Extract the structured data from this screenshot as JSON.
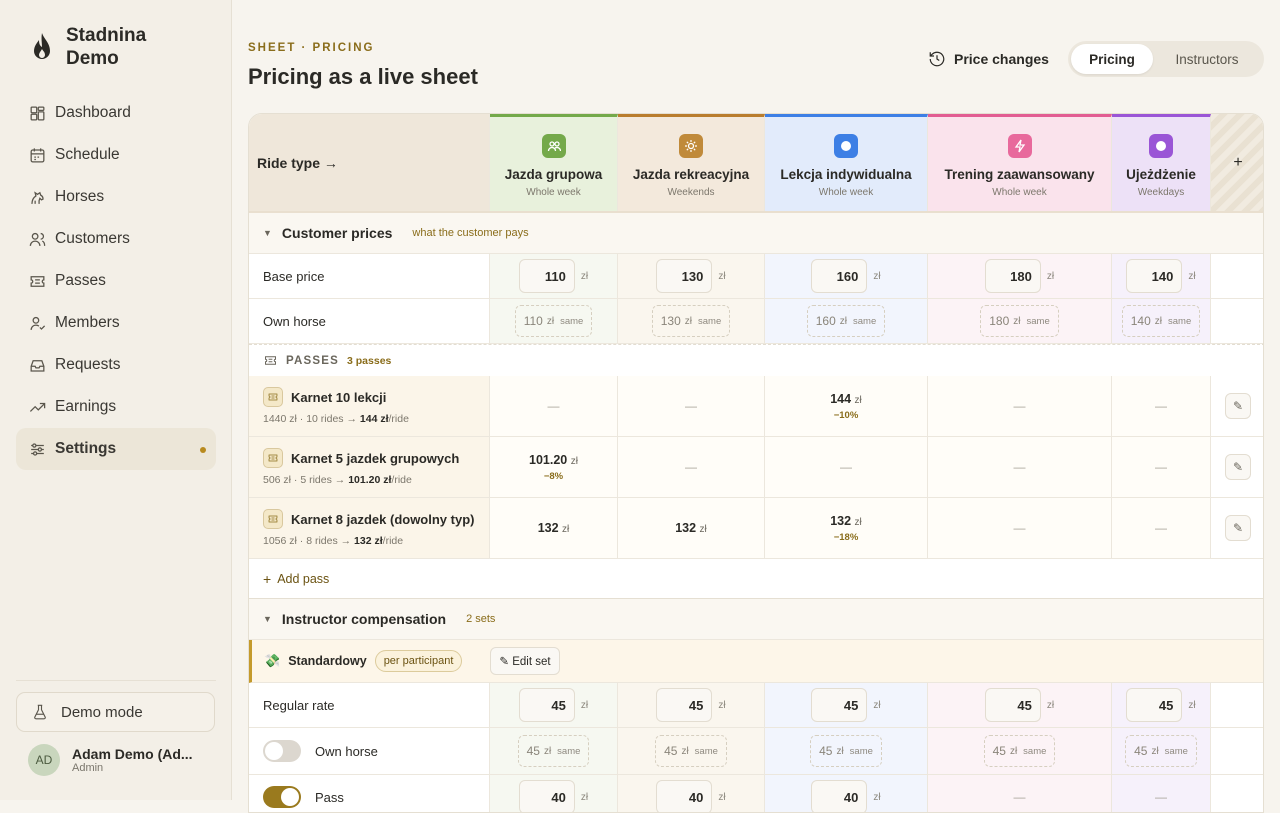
{
  "app": {
    "name": "Stadnina Demo"
  },
  "nav": [
    {
      "label": "Dashboard",
      "icon": "dashboard-icon"
    },
    {
      "label": "Schedule",
      "icon": "calendar-icon"
    },
    {
      "label": "Horses",
      "icon": "horse-icon"
    },
    {
      "label": "Customers",
      "icon": "users-icon"
    },
    {
      "label": "Passes",
      "icon": "ticket-icon"
    },
    {
      "label": "Members",
      "icon": "user-check-icon"
    },
    {
      "label": "Requests",
      "icon": "inbox-icon"
    },
    {
      "label": "Earnings",
      "icon": "trend-icon"
    },
    {
      "label": "Settings",
      "icon": "sliders-icon",
      "active": true
    }
  ],
  "demo": {
    "label": "Demo mode"
  },
  "user": {
    "initials": "AD",
    "name": "Adam Demo (Ad...",
    "role": "Admin"
  },
  "header": {
    "eyebrow": "SHEET · PRICING",
    "title": "Pricing as a live sheet",
    "price_changes": "Price changes",
    "tabs": [
      "Pricing",
      "Instructors"
    ]
  },
  "sheet": {
    "corner": "Ride type →",
    "add_col": "+",
    "columns": [
      {
        "name": "Jazda grupowa",
        "sub": "Whole week",
        "color": "#74a94a"
      },
      {
        "name": "Jazda rekreacyjna",
        "sub": "Weekends",
        "color": "#b97d2e"
      },
      {
        "name": "Lekcja indywidualna",
        "sub": "Whole week",
        "color": "#3d7fe5"
      },
      {
        "name": "Trening zaawansowany",
        "sub": "Whole week",
        "color": "#e25d92"
      },
      {
        "name": "Ujeżdżenie",
        "sub": "Weekdays",
        "color": "#9a55d6"
      }
    ],
    "unit": "zł",
    "same": "same",
    "customer": {
      "title": "Customer prices",
      "note": "what the customer pays",
      "base_label": "Base price",
      "base": [
        "110",
        "130",
        "160",
        "180",
        "140"
      ],
      "own_label": "Own horse",
      "own": [
        "110",
        "130",
        "160",
        "180",
        "140"
      ]
    },
    "passes": {
      "title": "PASSES",
      "count": "3 passes",
      "rows": [
        {
          "name": "Karnet 10 lekcji",
          "sub_pre": "1440 zł · 10 rides →",
          "sub_val": "144 zł",
          "sub_post": "/ride",
          "cells": [
            null,
            null,
            {
              "v": "144",
              "d": "−10%"
            },
            null,
            null
          ]
        },
        {
          "name": "Karnet 5 jazdek grupowych",
          "sub_pre": "506 zł · 5 rides →",
          "sub_val": "101.20 zł",
          "sub_post": "/ride",
          "cells": [
            {
              "v": "101.20",
              "d": "−8%"
            },
            null,
            null,
            null,
            null
          ]
        },
        {
          "name": "Karnet 8 jazdek (dowolny typ)",
          "sub_pre": "1056 zł · 8 rides →",
          "sub_val": "132 zł",
          "sub_post": "/ride",
          "cells": [
            {
              "v": "132",
              "d": ""
            },
            {
              "v": "132",
              "d": ""
            },
            {
              "v": "132",
              "d": "−18%"
            },
            null,
            null
          ]
        }
      ],
      "dash": "—",
      "add": "Add pass"
    },
    "instructor": {
      "title": "Instructor compensation",
      "count": "2 sets",
      "set_name": "Standardowy",
      "set_badge": "per participant",
      "set_edit": "✎ Edit set",
      "regular_label": "Regular rate",
      "regular": [
        "45",
        "45",
        "45",
        "45",
        "45"
      ],
      "own_label": "Own horse",
      "own": [
        "45",
        "45",
        "45",
        "45",
        "45"
      ],
      "pass_label": "Pass",
      "pass": [
        "40",
        "40",
        "40",
        "—",
        "—"
      ]
    }
  }
}
